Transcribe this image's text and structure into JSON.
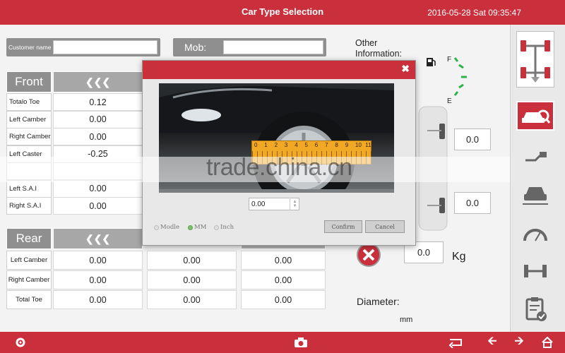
{
  "header": {
    "title": "Car Type Selection",
    "datetime": "2016-05-28 Sat 09:35:47"
  },
  "customer": {
    "name_label": "Customer name",
    "name_value": "",
    "mob_label": "Mob:",
    "mob_value": ""
  },
  "other_info_label": "Other Information:",
  "gauge": {
    "full_label": "F",
    "empty_label": "E"
  },
  "front": {
    "title": "Front",
    "rows": [
      {
        "label": "Totalo Toe",
        "values": [
          "0.12"
        ]
      },
      {
        "label": "Left Camber",
        "values": [
          "0.00"
        ]
      },
      {
        "label": "Right Camber",
        "values": [
          "0.00"
        ]
      },
      {
        "label": "Left Caster",
        "values": [
          "-0.25"
        ]
      },
      {
        "label": "",
        "values": [
          ""
        ]
      },
      {
        "label": "Left S.A.I",
        "values": [
          "0.00"
        ]
      },
      {
        "label": "Right S.A.I",
        "values": [
          "0.00"
        ]
      }
    ]
  },
  "rear": {
    "title": "Rear",
    "rows": [
      {
        "label": "Left Camber",
        "values": [
          "0.00",
          "0.00",
          "0.00"
        ]
      },
      {
        "label": "Right Camber",
        "values": [
          "0.00",
          "0.00",
          "0.00"
        ]
      },
      {
        "label": "Total Toe",
        "values": [
          "0.00",
          "0.00",
          "0.00"
        ]
      }
    ]
  },
  "right_values": {
    "value1": "0.0",
    "value2": "0.0"
  },
  "weight": {
    "value": "0.0",
    "unit": "Kg"
  },
  "diameter": {
    "label": "Diameter:",
    "unit": "mm"
  },
  "dialog": {
    "input_value": "0.00",
    "ruler_numbers": [
      "0",
      "1",
      "2",
      "3",
      "4",
      "5",
      "6",
      "7",
      "8",
      "9",
      "10",
      "11"
    ],
    "options": [
      {
        "label": "Modle",
        "selected": false
      },
      {
        "label": "MM",
        "selected": true
      },
      {
        "label": "Inch",
        "selected": false
      }
    ],
    "confirm_label": "Confirm",
    "cancel_label": "Cancel"
  },
  "watermark": "trade.china.cn",
  "colors": {
    "accent": "#c9303c",
    "gauge_green": "#2db14a",
    "gray_header": "#8f8f8f"
  },
  "icons": {
    "sidebar": [
      "wheel-alignment-icon",
      "car-search-icon",
      "lift-icon",
      "car-front-icon",
      "speedometer-icon",
      "axle-icon",
      "clipboard-check-icon"
    ],
    "bottom": [
      "gear-icon",
      "camera-icon",
      "return-icon",
      "arrow-left-icon",
      "arrow-right-icon",
      "home-icon"
    ]
  }
}
